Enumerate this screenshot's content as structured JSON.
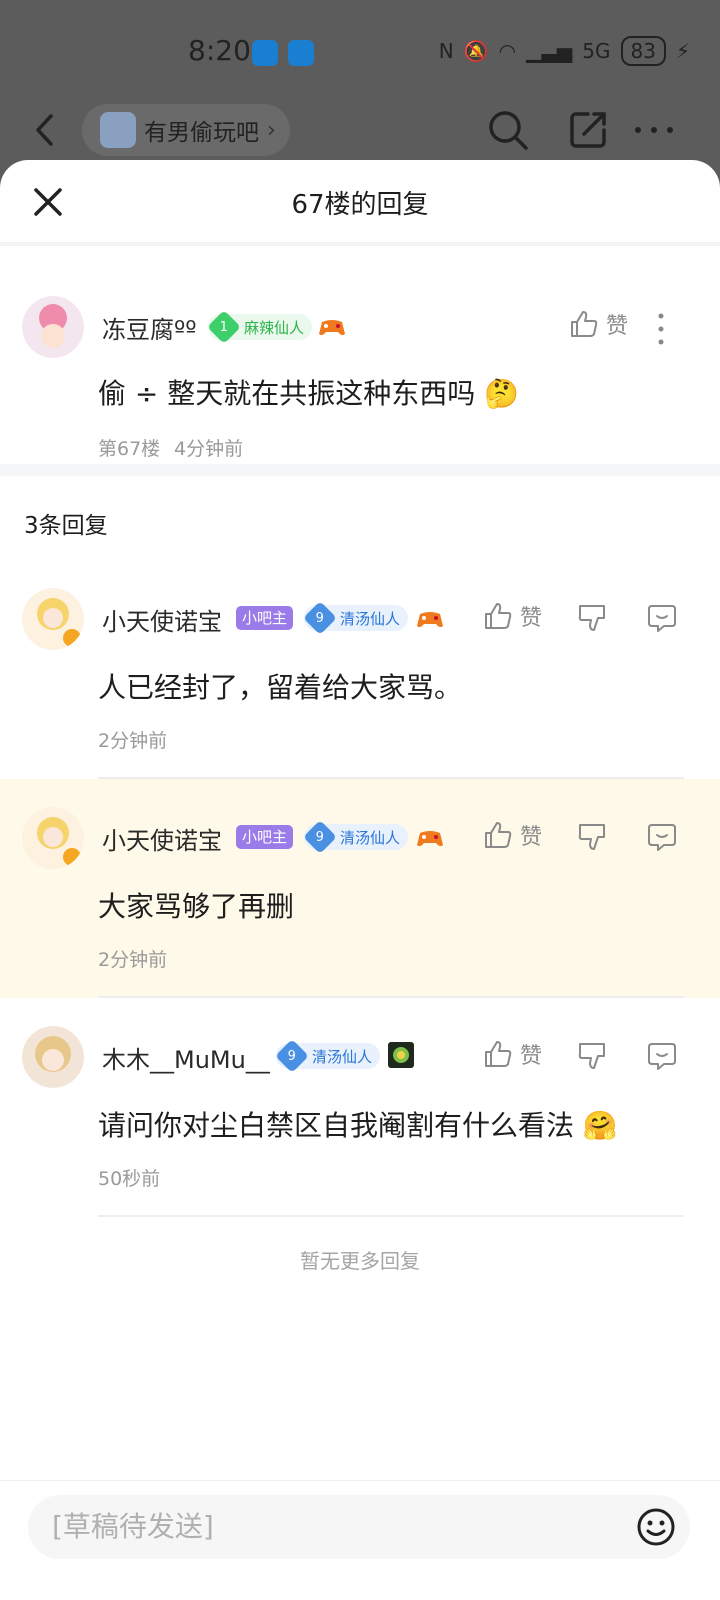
{
  "status": {
    "time": "8:20",
    "battery": "83",
    "network": "5G"
  },
  "topbar": {
    "forum_name": "有男偷玩吧"
  },
  "sheet": {
    "title": "67楼的回复",
    "reply_count": "3条回复",
    "no_more": "暂无更多回复"
  },
  "main_post": {
    "username": "冻豆腐ºº",
    "level": "1",
    "badge": "麻辣仙人",
    "like_label": "赞",
    "content": "偷 ÷ 整天就在共振这种东西吗",
    "floor": "第67楼",
    "time": "4分钟前"
  },
  "replies": [
    {
      "username": "小天使诺宝",
      "role": "小吧主",
      "level": "9",
      "badge": "清汤仙人",
      "like_label": "赞",
      "content": "人已经封了，留着给大家骂。",
      "time": "2分钟前"
    },
    {
      "username": "小天使诺宝",
      "role": "小吧主",
      "level": "9",
      "badge": "清汤仙人",
      "like_label": "赞",
      "content": "大家骂够了再删",
      "time": "2分钟前"
    },
    {
      "username": "木木__MuMu__",
      "level": "9",
      "badge": "清汤仙人",
      "like_label": "赞",
      "content": "请问你对尘白禁区自我阉割有什么看法",
      "time": "50秒前"
    }
  ],
  "input": {
    "placeholder": "[草稿待发送]"
  },
  "colors": {
    "highlight_bg": "#fff9e9",
    "accent_blue": "#4a90e2",
    "accent_green": "#3ccf6a",
    "role_purple": "#9b7be8"
  }
}
